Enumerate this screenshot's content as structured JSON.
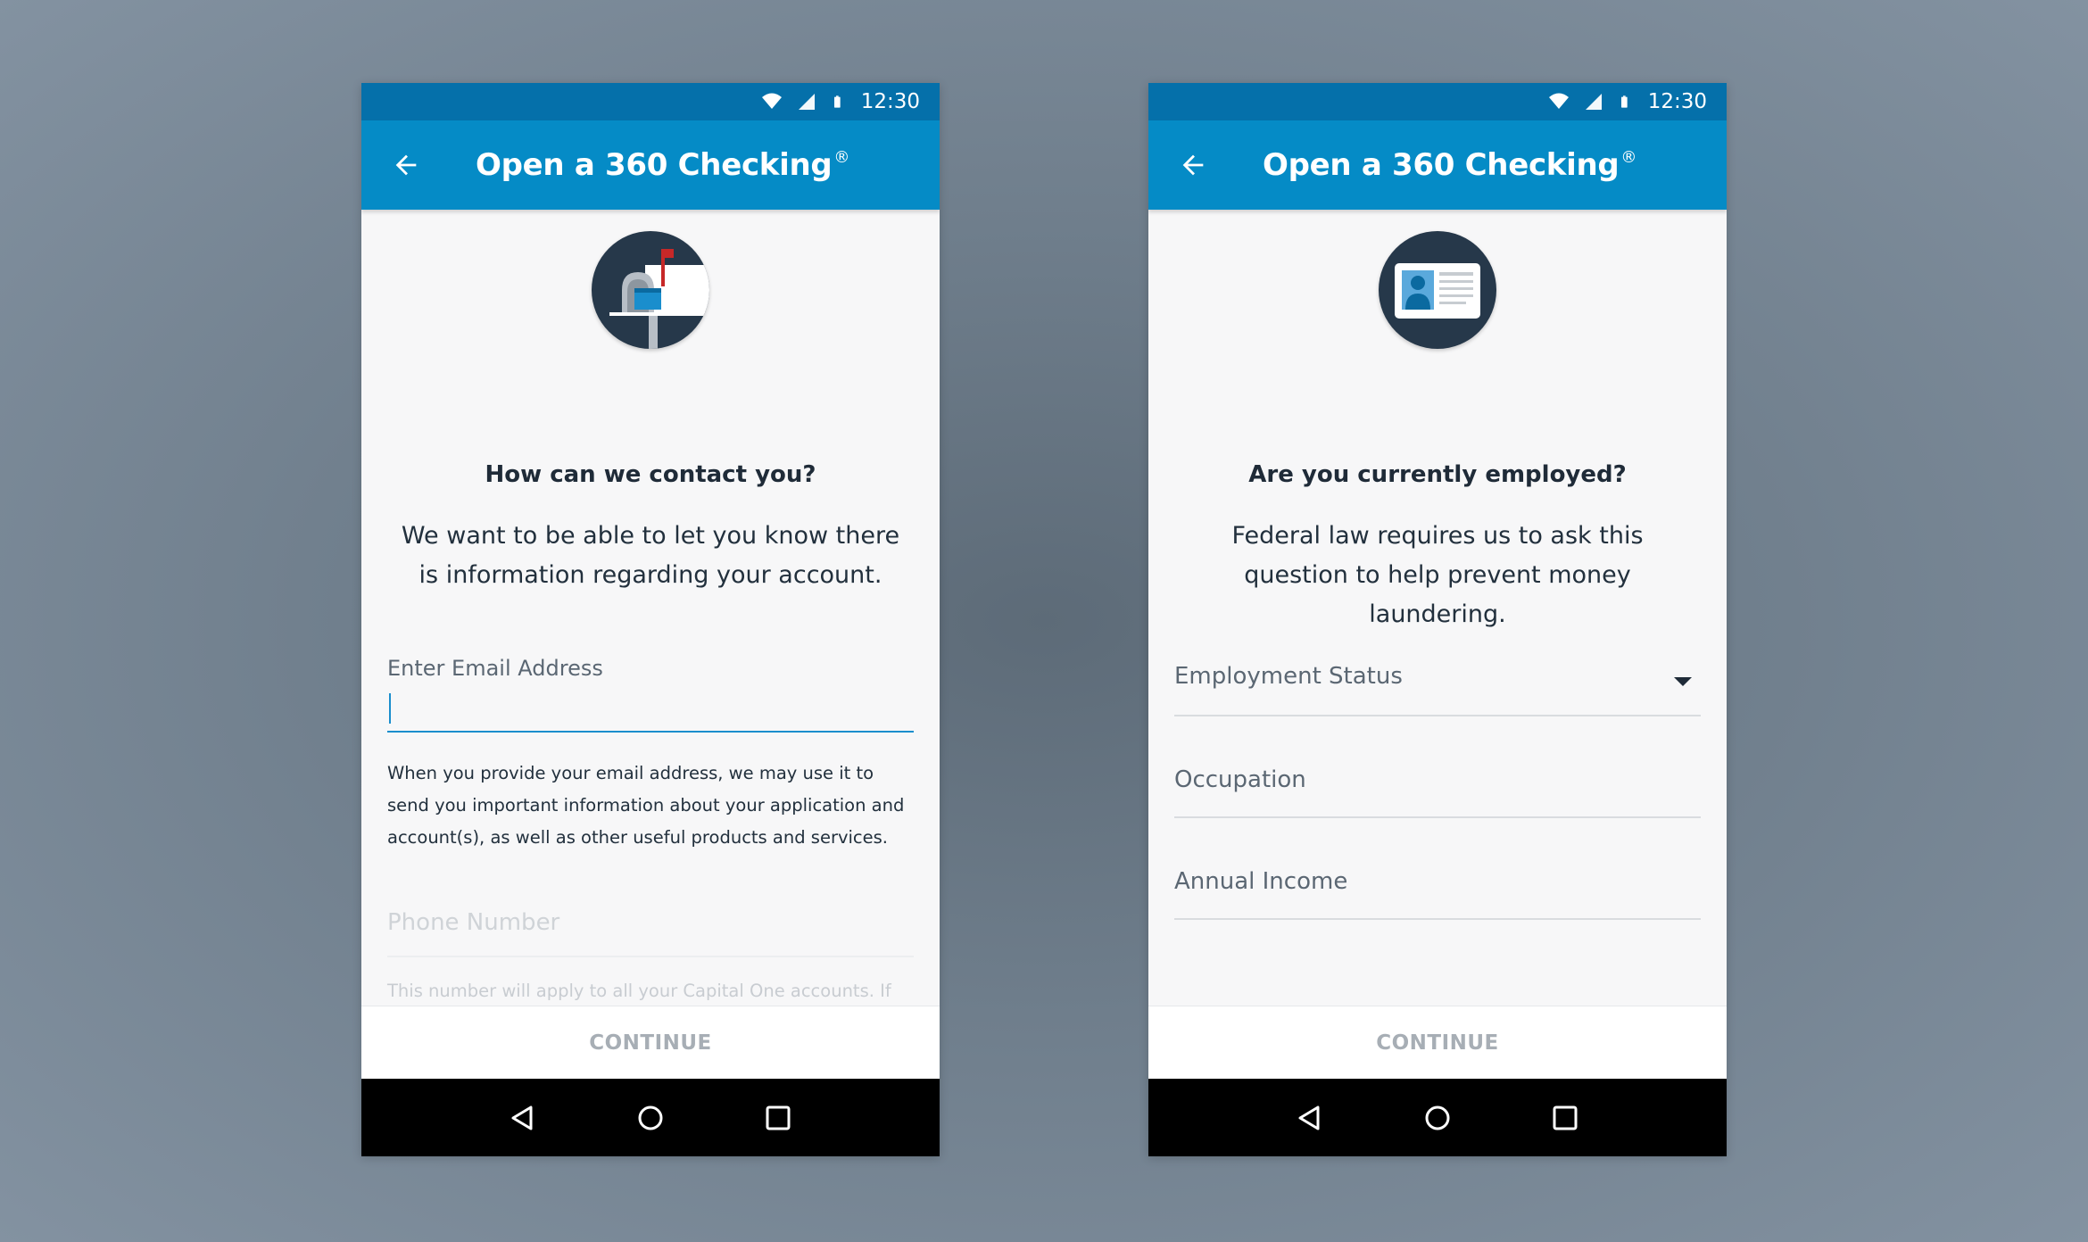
{
  "screens": [
    {
      "status_bar": {
        "time": "12:30"
      },
      "app_bar": {
        "title": "Open a 360 Checking",
        "title_mark": "®"
      },
      "heading": "How can we contact you?",
      "subtext": "We want to be able to let you know there is information regarding your account.",
      "email_field": {
        "label": "Enter Email Address",
        "value": ""
      },
      "email_helper": "When you provide your email address, we may use it to send you important information about your application and account(s), as well as other useful products and services.",
      "phone_field": {
        "label": "Phone Number"
      },
      "phone_helper": "This number will apply to all your Capital One accounts. If left blank, previously provided numbers and alerts may be deleted.",
      "continue_label": "CONTINUE"
    },
    {
      "status_bar": {
        "time": "12:30"
      },
      "app_bar": {
        "title": "Open a 360 Checking",
        "title_mark": "®"
      },
      "heading": "Are you currently employed?",
      "subtext": "Federal law requires us to ask this question to help prevent money laundering.",
      "employment_status": {
        "label": "Employment Status"
      },
      "occupation": {
        "label": "Occupation"
      },
      "annual_income": {
        "label": "Annual Income"
      },
      "continue_label": "CONTINUE"
    }
  ],
  "icons": {
    "status": [
      "wifi-icon",
      "cell-signal-icon",
      "battery-icon"
    ],
    "app_bar": "back-arrow-icon",
    "screen_left_hero": "mailbox-icon",
    "screen_right_hero": "id-card-icon",
    "nav": [
      "nav-back-icon",
      "nav-home-icon",
      "nav-recents-icon"
    ]
  },
  "colors": {
    "status_bar": "#0570aa",
    "app_bar": "#058bc6",
    "accent": "#1a8ecd",
    "hero_bg": "#26384a",
    "text_dark": "#1f2b38",
    "disabled_text": "#a7aeb5"
  }
}
